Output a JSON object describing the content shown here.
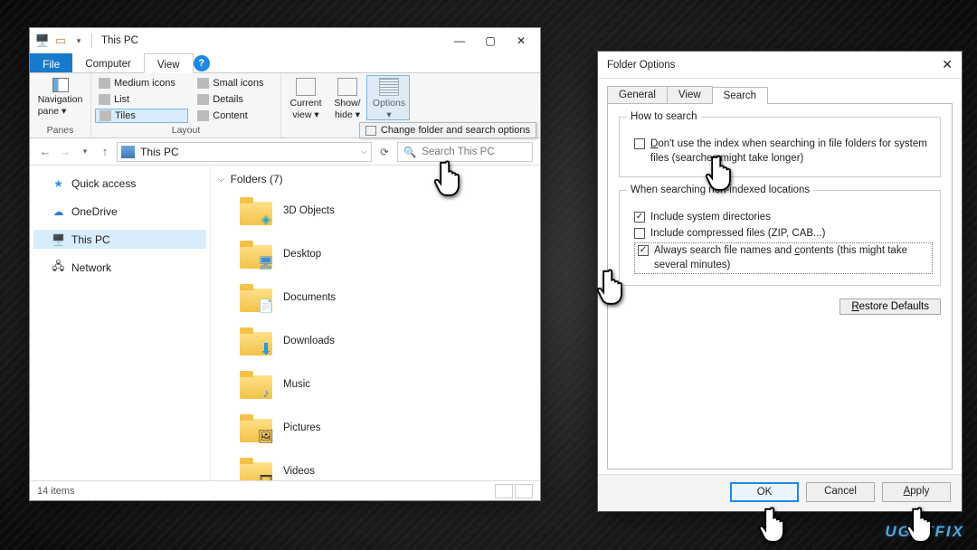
{
  "explorer": {
    "title": "This PC",
    "tabs": {
      "file": "File",
      "computer": "Computer",
      "view": "View"
    },
    "ribbon": {
      "panes": {
        "navpane": "Navigation\npane",
        "label": "Panes"
      },
      "layout": {
        "items": [
          "Medium icons",
          "Small icons",
          "List",
          "Details",
          "Tiles",
          "Content"
        ],
        "selected": "Tiles",
        "label": "Layout"
      },
      "view": {
        "current": "Current\nview",
        "showhide": "Show/\nhide",
        "options": "Options"
      },
      "tooltip": "Change folder and search options"
    },
    "address": "This PC",
    "search_placeholder": "Search This PC",
    "sidebar": {
      "quick": "Quick access",
      "onedrive": "OneDrive",
      "thispc": "This PC",
      "network": "Network"
    },
    "folders_header": "Folders (7)",
    "folders": [
      "3D Objects",
      "Desktop",
      "Documents",
      "Downloads",
      "Music",
      "Pictures",
      "Videos"
    ],
    "status": "14 items"
  },
  "dialog": {
    "title": "Folder Options",
    "tabs": {
      "general": "General",
      "view": "View",
      "search": "Search"
    },
    "how_to_search": {
      "legend": "How to search",
      "no_index": "Don't use the index when searching in file folders for system files (searches might take longer)"
    },
    "non_indexed": {
      "legend": "When searching non-indexed locations",
      "sys_dirs": "Include system directories",
      "compressed": "Include compressed files (ZIP, CAB...)",
      "always": "Always search file names and contents (this might take several minutes)"
    },
    "restore": "Restore Defaults",
    "buttons": {
      "ok": "OK",
      "cancel": "Cancel",
      "apply": "Apply"
    }
  },
  "watermark": "UGETFIX"
}
